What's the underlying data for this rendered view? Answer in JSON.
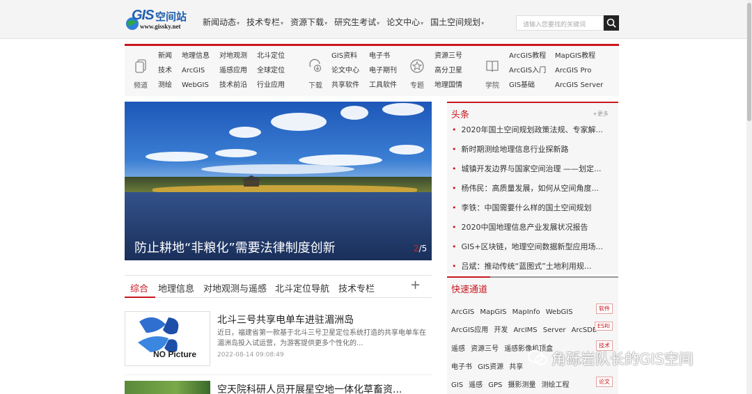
{
  "logo": {
    "gis": "GIS",
    "cn": "空间站",
    "url": "www.gissky.net"
  },
  "nav": [
    "新闻动态",
    "技术专栏",
    "资源下载",
    "研究生考试",
    "论文中心",
    "国土空间规划"
  ],
  "search": {
    "placeholder": "请输入您要找的关键词"
  },
  "channels": [
    {
      "label": "频道",
      "icon": "copy-icon",
      "cols": [
        [
          "新闻",
          "技术",
          "测绘"
        ],
        [
          "地理信息",
          "ArcGIS",
          "WebGIS"
        ],
        [
          "对地观测",
          "遥感应用",
          "技术前沿"
        ],
        [
          "北斗定位",
          "全球定位",
          "行业应用"
        ]
      ]
    },
    {
      "label": "下载",
      "icon": "download-icon",
      "cols": [
        [
          "GIS资料",
          "论文中心",
          "共享软件"
        ],
        [
          "电子书",
          "电子期刊",
          "工具软件"
        ]
      ]
    },
    {
      "label": "专题",
      "icon": "star-icon",
      "cols": [
        [
          "资源三号",
          "高分卫星",
          "地理国情"
        ]
      ]
    },
    {
      "label": "学院",
      "icon": "book-icon",
      "cols": [
        [
          "ArcGIS教程",
          "ArcGIS入门",
          "GIS基础"
        ],
        [
          "MapGIS教程",
          "ArcGIS Pro",
          "ArcGIS Server"
        ]
      ]
    }
  ],
  "banner": {
    "caption": "防止耕地“非粮化”需要法律制度创新",
    "page_current": "2",
    "page_total": "/5"
  },
  "tabs": [
    "综合",
    "地理信息",
    "对地观测与遥感",
    "北斗定位导航",
    "技术专栏"
  ],
  "tab_plus": "+",
  "articles": [
    {
      "title": "北斗三号共享电单车进驻湄洲岛",
      "summary": "近日，福建省第一款基于北斗三号卫星定位系统打造的共享电单车在湄洲岛投入试运营，为游客提供更多个性化的...",
      "date": "2022-08-14 09:08:49",
      "thumb_text": "NO Picture"
    },
    {
      "title": "空天院科研人员开展星空地一体化草畜资...",
      "summary": "",
      "date": "",
      "thumb_text": ""
    }
  ],
  "headlines": {
    "title": "头条",
    "more": "+更多",
    "items": [
      "2020年国土空间规划政策法规、专家解...",
      "新时期测绘地理信息行业探新路",
      "城镇开发边界与国家空间治理 ——划定...",
      "杨伟民：高质量发展，如何从空间角度...",
      "李铁：中国需要什么样的国土空间规划",
      "2020中国地理信息产业发展状况报告",
      "GIS+区块链，地理空间数据新型应用场...",
      "吕斌：推动传统“蓝图式”土地利用规..."
    ]
  },
  "fast": {
    "title": "快速通道",
    "rows": [
      {
        "words": [
          "ArcGIS",
          "MapGIS",
          "MapInfo",
          "WebGIS"
        ],
        "tag": "软件"
      },
      {
        "words": [
          "ArcGIS应用",
          "开发",
          "ArcIMS",
          "Server",
          "ArcSDE"
        ],
        "tag": "ESRI"
      },
      {
        "words": [
          "遥感",
          "资源三号",
          "遥感影像机顶盒"
        ],
        "tag": "技术"
      },
      {
        "words": [
          "电子书",
          "GIS资源",
          "共享"
        ],
        "tag": ""
      },
      {
        "words": [
          "GIS",
          "遥感",
          "GPS",
          "摄影测量",
          "测绘工程"
        ],
        "tag": "论文"
      }
    ]
  },
  "watermark": "角砾岩队长的GIS空间",
  "colors": {
    "accent": "#c8161d",
    "logo_blue": "#1f5fb0"
  }
}
